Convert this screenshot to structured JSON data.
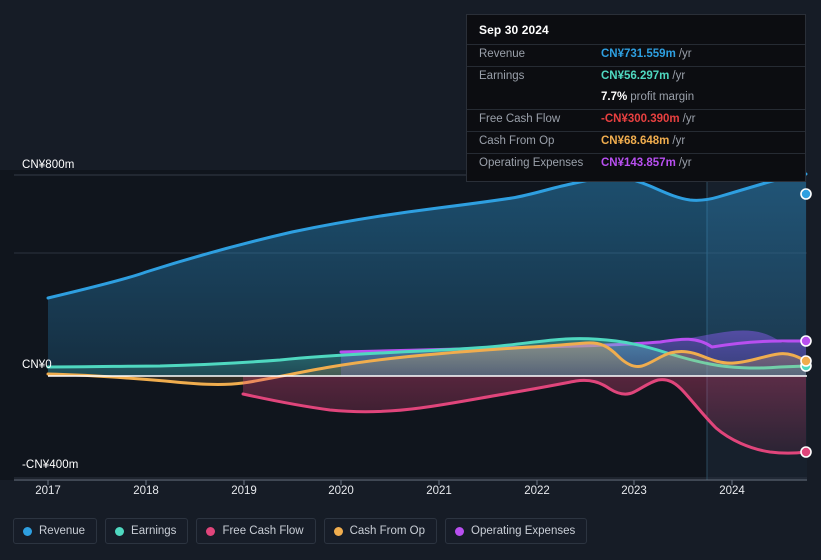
{
  "colors": {
    "background": "#161c26",
    "plot_background": "#10151d",
    "forecast_background": "#141d28",
    "gridline": "#2b3240",
    "zero_line": "#ffffff",
    "revenue": "#2e9fe0",
    "earnings": "#4fd8c0",
    "free_cash_flow": "#e0457b",
    "cash_from_op": "#f0ad4e",
    "operating_expenses": "#b84ff0",
    "tooltip_background": "#0c0d11",
    "tooltip_border": "#2a2f38",
    "label_muted": "#9aa0aa"
  },
  "tooltip": {
    "date": "Sep 30 2024",
    "rows": [
      {
        "label": "Revenue",
        "value": "CN¥731.559m",
        "suffix": "/yr",
        "color": "#2e9fe0"
      },
      {
        "label": "Earnings",
        "value": "CN¥56.297m",
        "suffix": "/yr",
        "color": "#4fd8c0"
      },
      {
        "label": "",
        "value": "7.7%",
        "suffix": "profit margin",
        "color": "#ffffff"
      },
      {
        "label": "Free Cash Flow",
        "value": "-CN¥300.390m",
        "suffix": "/yr",
        "color": "#e84040"
      },
      {
        "label": "Cash From Op",
        "value": "CN¥68.648m",
        "suffix": "/yr",
        "color": "#f0ad4e"
      },
      {
        "label": "Operating Expenses",
        "value": "CN¥143.857m",
        "suffix": "/yr",
        "color": "#b84ff0"
      }
    ]
  },
  "legend": {
    "items": [
      {
        "label": "Revenue",
        "color": "#2e9fe0"
      },
      {
        "label": "Earnings",
        "color": "#4fd8c0"
      },
      {
        "label": "Free Cash Flow",
        "color": "#e0457b"
      },
      {
        "label": "Cash From Op",
        "color": "#f0ad4e"
      },
      {
        "label": "Operating Expenses",
        "color": "#b84ff0"
      }
    ]
  },
  "chart_data": {
    "type": "area",
    "title": "",
    "xlabel": "",
    "ylabel": "",
    "currency": "CN¥",
    "units": "m",
    "grid": true,
    "legend_position": "bottom-left",
    "y_axis": {
      "labels": [
        "CN¥800m",
        "CN¥0",
        "-CN¥400m"
      ],
      "ticks": [
        800,
        400,
        0,
        -400
      ],
      "ylim": [
        -480,
        880
      ],
      "gridlines_at": [
        800,
        400,
        -400
      ],
      "zero_line_at": 0
    },
    "x_axis": {
      "tick_labels": [
        "2017",
        "2018",
        "2019",
        "2020",
        "2021",
        "2022",
        "2023",
        "2024"
      ],
      "xlim": [
        "2016.75",
        "2025.05"
      ],
      "forecast_starts": "2023.65"
    },
    "series": [
      {
        "name": "Revenue",
        "color": "#2e9fe0",
        "x": [
          2016.9,
          2017.5,
          2018.0,
          2018.5,
          2019.0,
          2019.5,
          2020.0,
          2020.5,
          2021.0,
          2021.5,
          2022.0,
          2022.4,
          2022.75,
          2023.0,
          2023.35,
          2023.65,
          2024.0,
          2024.4,
          2024.75
        ],
        "values": [
          312,
          352,
          390,
          424,
          452,
          478,
          500,
          520,
          540,
          560,
          600,
          660,
          700,
          680,
          620,
          600,
          612,
          660,
          720
        ],
        "end_value": 731.559
      },
      {
        "name": "Earnings",
        "color": "#4fd8c0",
        "x": [
          2016.9,
          2017.5,
          2018.0,
          2018.5,
          2019.0,
          2019.5,
          2020.0,
          2020.5,
          2021.0,
          2021.5,
          2022.0,
          2022.5,
          2022.9,
          2023.2,
          2023.65,
          2024.0,
          2024.4,
          2024.75
        ],
        "values": [
          14,
          14,
          15,
          16,
          17,
          22,
          30,
          32,
          36,
          44,
          58,
          78,
          84,
          76,
          58,
          44,
          42,
          48
        ],
        "end_value": 56.297
      },
      {
        "name": "Free Cash Flow",
        "color": "#e0457b",
        "x": [
          2018.45,
          2018.8,
          2019.2,
          2019.7,
          2020.2,
          2020.8,
          2021.4,
          2022.0,
          2022.4,
          2022.7,
          2022.95,
          2023.2,
          2023.65,
          2024.0,
          2024.4,
          2024.75
        ],
        "values": [
          -48,
          -72,
          -88,
          -84,
          -70,
          -54,
          -38,
          -24,
          -14,
          -36,
          -18,
          -44,
          -120,
          -190,
          -262,
          -296
        ],
        "end_value": -300.39
      },
      {
        "name": "Cash From Op",
        "color": "#f0ad4e",
        "x": [
          2016.9,
          2017.4,
          2018.0,
          2018.5,
          2019.0,
          2019.5,
          2020.0,
          2020.5,
          2021.0,
          2021.5,
          2022.0,
          2022.4,
          2022.7,
          2022.95,
          2023.2,
          2023.6,
          2024.0,
          2024.4,
          2024.75
        ],
        "values": [
          6,
          4,
          -4,
          -16,
          -22,
          -10,
          8,
          20,
          30,
          42,
          56,
          70,
          32,
          60,
          34,
          30,
          58,
          80,
          66
        ],
        "end_value": 68.648
      },
      {
        "name": "Operating Expenses",
        "color": "#b84ff0",
        "x": [
          2019.75,
          2020.2,
          2020.8,
          2021.4,
          2022.0,
          2022.5,
          2023.0,
          2023.4,
          2023.65,
          2024.0,
          2024.4,
          2024.75
        ],
        "values": [
          52,
          54,
          56,
          58,
          62,
          70,
          78,
          90,
          110,
          126,
          138,
          142
        ],
        "end_value": 143.857
      }
    ]
  }
}
